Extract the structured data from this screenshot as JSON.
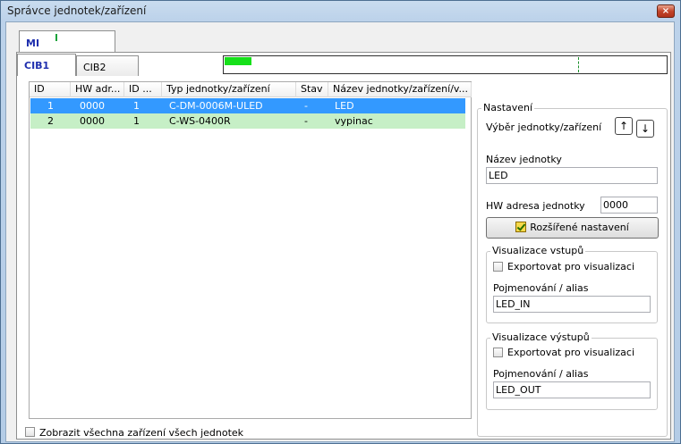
{
  "window": {
    "title": "Správce jednotek/zařízení",
    "close_glyph": "×"
  },
  "outer_tabs": [
    {
      "label": "MI"
    }
  ],
  "sub_tabs": [
    {
      "label": "CIB1",
      "active": true
    },
    {
      "label": "CIB2",
      "active": false
    }
  ],
  "progress": {
    "fill_fraction": 0.06
  },
  "table": {
    "headers": [
      "ID",
      "HW adr...",
      "ID ...",
      "Typ jednotky/zařízení",
      "Stav",
      "Název jednotky/zařízení/v..."
    ],
    "rows": [
      {
        "id": "1",
        "hw": "0000",
        "id2": "1",
        "typ": "C-DM-0006M-ULED",
        "stav": "-",
        "nazev": "LED",
        "selected": true
      },
      {
        "id": "2",
        "hw": "0000",
        "id2": "1",
        "typ": "C-WS-0400R",
        "stav": "-",
        "nazev": "vypinac",
        "selected": false
      }
    ]
  },
  "settings": {
    "group_title": "Nastavení",
    "select_label": "Výběr jednotky/zařízení",
    "up_glyph": "↑",
    "down_glyph": "↓",
    "unit_name_label": "Název jednotky",
    "unit_name_value": "LED",
    "hw_label": "HW adresa jednotky",
    "hw_value": "0000",
    "advanced_button": "Rozšířené nastavení"
  },
  "vis_inputs": {
    "group_title": "Visualizace vstupů",
    "export_label": "Exportovat pro visualizaci",
    "alias_label": "Pojmenování / alias",
    "alias_value": "LED_IN"
  },
  "vis_outputs": {
    "group_title": "Visualizace výstupů",
    "export_label": "Exportovat pro visualizaci",
    "alias_label": "Pojmenování / alias",
    "alias_value": "LED_OUT"
  },
  "footer": {
    "show_all_label": "Zobrazit všechna zařízení všech jednotek"
  },
  "colors": {
    "selected_row": "#3399ff",
    "alt_row": "#c6efc6",
    "progress_fill": "#16e01a",
    "tab_text": "#1f2fae"
  }
}
